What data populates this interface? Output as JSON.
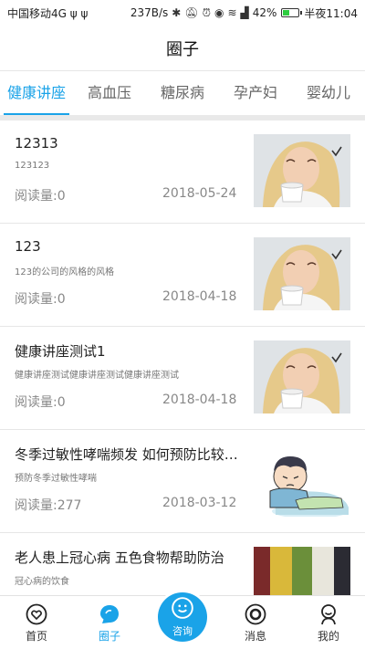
{
  "status_bar": {
    "carrier": "中国移动4G ψ ψ",
    "speed": "237B/s",
    "battery": "42%",
    "battery_level": 0.42,
    "time": "半夜11:04"
  },
  "header": {
    "title": "圈子"
  },
  "tabs": [
    {
      "label": "健康讲座",
      "active": true
    },
    {
      "label": "高血压",
      "active": false
    },
    {
      "label": "糖尿病",
      "active": false
    },
    {
      "label": "孕产妇",
      "active": false
    },
    {
      "label": "婴幼儿",
      "active": false
    }
  ],
  "articles": [
    {
      "title": "12313",
      "desc": "123123",
      "reads": "阅读量:0",
      "date": "2018-05-24",
      "thumb": "woman-cup"
    },
    {
      "title": "123",
      "desc": "123的公司的风格的风格",
      "reads": "阅读量:0",
      "date": "2018-04-18",
      "thumb": "woman-cup"
    },
    {
      "title": "健康讲座测试1",
      "desc": "健康讲座测试健康讲座测试健康讲座测试",
      "reads": "阅读量:0",
      "date": "2018-04-18",
      "thumb": "woman-cup"
    },
    {
      "title": "冬季过敏性哮喘频发 如何预防比较…",
      "desc": "预防冬季过敏性哮喘",
      "reads": "阅读量:277",
      "date": "2018-03-12",
      "thumb": "sick-boy-cartoon"
    },
    {
      "title": "老人患上冠心病 五色食物帮助防治",
      "desc": "冠心病的饮食",
      "reads": "",
      "date": "",
      "thumb": "grain-stripes"
    }
  ],
  "bottom_nav": [
    {
      "label": "首页",
      "icon": "heart-icon",
      "active": false
    },
    {
      "label": "圈子",
      "icon": "chat-bubble-icon",
      "active": true
    },
    {
      "label": "咨询",
      "icon": "smiley-icon",
      "active": false
    },
    {
      "label": "消息",
      "icon": "target-icon",
      "active": false
    },
    {
      "label": "我的",
      "icon": "person-icon",
      "active": false
    }
  ],
  "colors": {
    "accent": "#1aa3e8",
    "divider": "#e6e6e6"
  }
}
